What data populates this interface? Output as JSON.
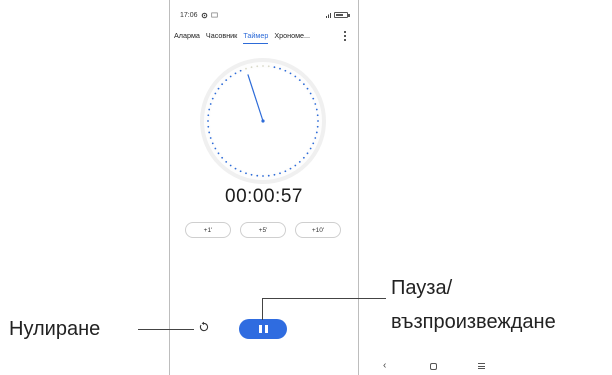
{
  "status": {
    "time": "17:06",
    "signal_text": "ₗ",
    "battery_level": 0.7
  },
  "tabs": [
    {
      "label": "Аларма"
    },
    {
      "label": "Часовник"
    },
    {
      "label": "Таймер"
    },
    {
      "label": "Хрономе..."
    }
  ],
  "active_tab": "Таймер",
  "timer": {
    "display": "00:00:57",
    "elapsed_fraction": 0.05
  },
  "add_buttons": [
    {
      "label": "+1'"
    },
    {
      "label": "+5'"
    },
    {
      "label": "+10'"
    }
  ],
  "callouts": {
    "reset_label": "Нулиране",
    "pause_label_line1": "Пауза/",
    "pause_label_line2": "възпроизвеждане"
  },
  "icons": {
    "settings": "gear-icon",
    "reset": "reset-icon",
    "pause": "pause-icon",
    "back": "back-icon",
    "home": "home-icon",
    "recents": "recents-icon",
    "menu": "kebab-menu-icon"
  },
  "colors": {
    "accent": "#2f6ce0",
    "dots": "#2d6bd8",
    "ring": "#f0f0f0"
  }
}
